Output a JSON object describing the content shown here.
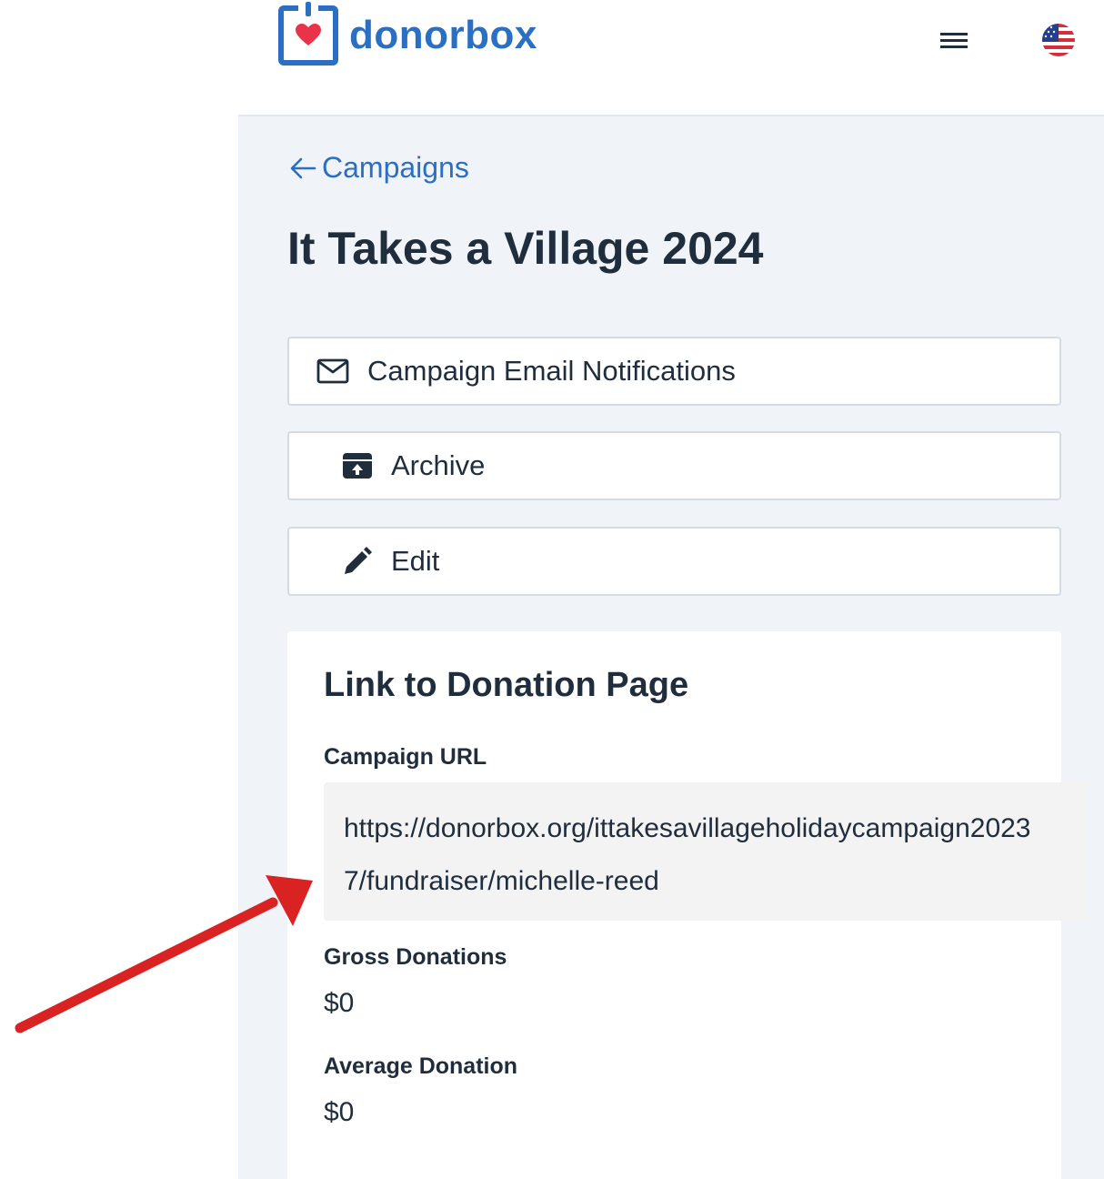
{
  "header": {
    "logo_text": "donorbox",
    "menu_icon": "hamburger-menu-icon",
    "language_icon": "us-flag-icon"
  },
  "breadcrumb": {
    "back_label": "Campaigns"
  },
  "page": {
    "title": "It Takes a Village 2024"
  },
  "actions": {
    "email_label": "Campaign Email Notifications",
    "archive_label": "Archive",
    "edit_label": "Edit"
  },
  "card": {
    "title": "Link to Donation Page",
    "campaign_url_label": "Campaign URL",
    "campaign_url_line1": "https://donorbox.org/ittakesavillageholidaycampaign2023",
    "campaign_url_line2": "7/fundraiser/michelle-reed",
    "gross_donations_label": "Gross Donations",
    "gross_donations_value": "$0",
    "average_donation_label": "Average Donation",
    "average_donation_value": "$0"
  },
  "colors": {
    "brand_blue": "#2b6fc3",
    "heart_red": "#e8334a",
    "annotation_arrow": "#d92323",
    "panel_bg": "#f0f4f8"
  }
}
